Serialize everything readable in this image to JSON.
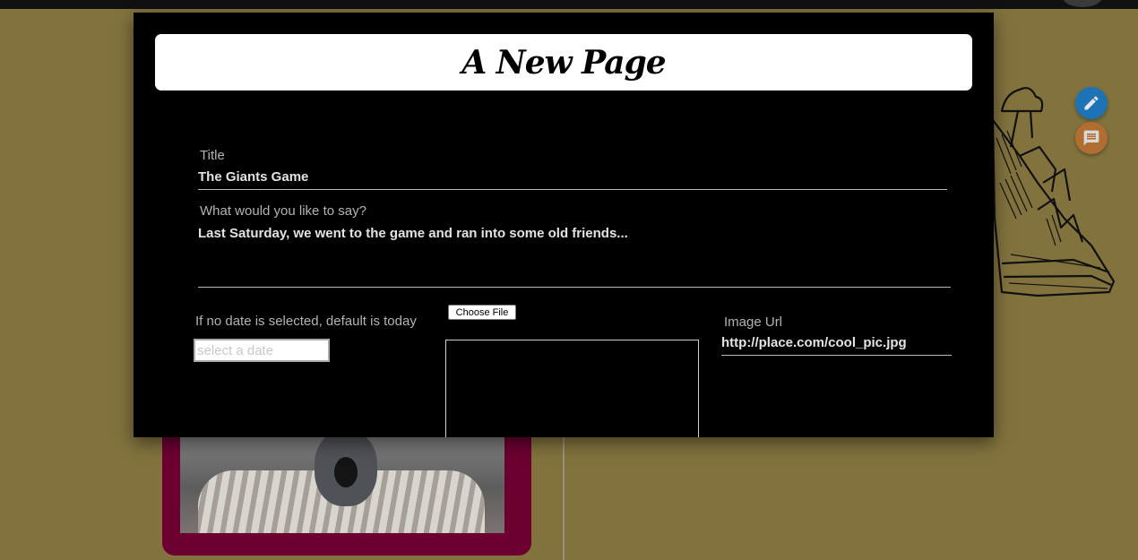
{
  "modal": {
    "title": "A New Page"
  },
  "form": {
    "title_label": "Title",
    "title_value": "The Giants Game",
    "message_label": "What would you like to say?",
    "message_value": "Last Saturday, we went to the game and ran into some old friends...",
    "date_hint": "If no date is selected, default is today",
    "date_placeholder": "select a date",
    "choose_file_label": "Choose File",
    "image_url_label": "Image Url",
    "image_url_value": "http://place.com/cool_pic.jpg"
  },
  "colors": {
    "background": "#82733e",
    "modal_background": "#000000",
    "card_frame": "#6c0030",
    "edit_button": "#1d73b6",
    "comment_button": "#b06e33"
  },
  "icons": {
    "edit_button": "pencil-icon",
    "comment_button": "comment-icon"
  }
}
